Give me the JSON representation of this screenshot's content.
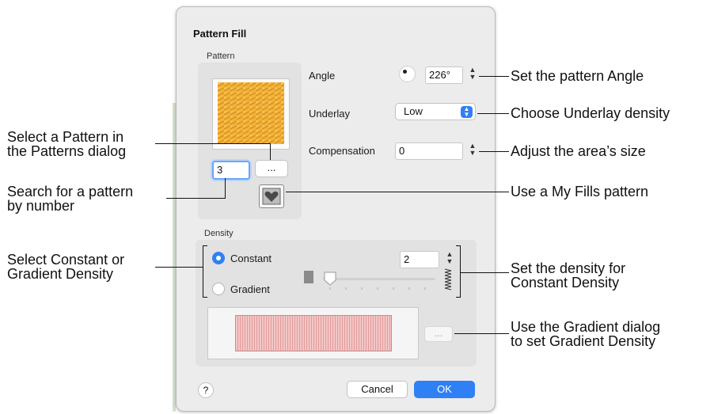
{
  "dialog": {
    "title": "Pattern Fill",
    "pattern_section_label": "Pattern",
    "density_section_label": "Density",
    "pattern_number": "3",
    "browse_button": "...",
    "angle": {
      "label": "Angle",
      "value": "226°"
    },
    "underlay": {
      "label": "Underlay",
      "value": "Low"
    },
    "compensation": {
      "label": "Compensation",
      "value": "0"
    },
    "density_mode": {
      "constant_label": "Constant",
      "gradient_label": "Gradient",
      "selected": "Constant"
    },
    "density_value": "2",
    "gradient_button": "...",
    "help_button": "?",
    "cancel_button": "Cancel",
    "ok_button": "OK",
    "colors": {
      "accent": "#2f80f5",
      "pattern_fill": "#f2b33a",
      "gradient": "#e8a5a5"
    }
  },
  "annotations": {
    "select_pattern_1": "Select a Pattern in",
    "select_pattern_2": "the Patterns dialog",
    "search_pattern_1": "Search for a pattern",
    "search_pattern_2": "by number",
    "select_constant_1": "Select Constant or",
    "select_constant_2": "Gradient Density",
    "set_angle": "Set the pattern Angle",
    "choose_underlay": "Choose Underlay density",
    "adjust_size": "Adjust the area’s size",
    "my_fills": "Use a My Fills pattern",
    "set_density_1": "Set the density for",
    "set_density_2": "Constant Density",
    "gradient_dialog_1": "Use the Gradient dialog",
    "gradient_dialog_2": "to set Gradient Density"
  }
}
